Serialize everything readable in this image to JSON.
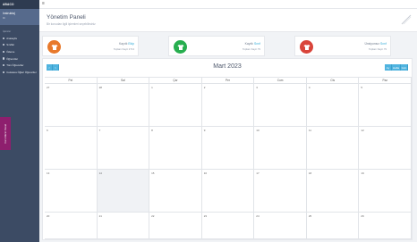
{
  "sidebar": {
    "brand": "ABACO",
    "user": {
      "name": "Instruktaj",
      "role": "IC"
    },
    "section_title": "İşlemler",
    "items": [
      {
        "label": "Anasayfa",
        "icon": "home-icon"
      },
      {
        "label": "Sınıflar",
        "icon": "list-icon"
      },
      {
        "label": "Ödeme",
        "icon": "money-icon"
      },
      {
        "label": "Öğrenciler",
        "icon": "users-icon"
      },
      {
        "label": "Tüm Öğrenciler",
        "icon": "users-icon"
      },
      {
        "label": "Codeless Öğleri Öğrenciler",
        "icon": "users-icon"
      }
    ]
  },
  "side_tab": {
    "label": "Cem Meric Panel"
  },
  "header": {
    "title": "Yönetim Paneli",
    "subtitle": "Bir konudan ilgili işlemleri seçebilirsiniz"
  },
  "stats": [
    {
      "label": "Kayıtlı",
      "accent": "Ekip",
      "sub": "Toplam Kayıt 2713",
      "color": "#e8792b",
      "icon": "tshirt-icon"
    },
    {
      "label": "Kayıtlı",
      "accent": "Sınıf",
      "sub": "Toplam Kayıt 79",
      "color": "#27ae4f",
      "icon": "tshirt-icon"
    },
    {
      "label": "Ünsiyonsız",
      "accent": "Sınıf",
      "sub": "Toplam Kayıt 79",
      "color": "#d9443a",
      "icon": "tshirt-icon"
    }
  ],
  "calendar": {
    "title": "Mart 2023",
    "prev_label": "<",
    "next_label": ">",
    "views": [
      "Ay",
      "Hafta",
      "Gün"
    ],
    "weekdays": [
      "Pzt",
      "Sal",
      "Çar",
      "Per",
      "Cum",
      "Cts",
      "Paz"
    ],
    "weeks": [
      [
        "27",
        "28",
        "1",
        "2",
        "3",
        "4",
        "5"
      ],
      [
        "6",
        "7",
        "8",
        "9",
        "10",
        "11",
        "12"
      ],
      [
        "13",
        "14",
        "15",
        "16",
        "17",
        "18",
        "19"
      ],
      [
        "20",
        "21",
        "22",
        "23",
        "24",
        "25",
        "26"
      ]
    ]
  }
}
